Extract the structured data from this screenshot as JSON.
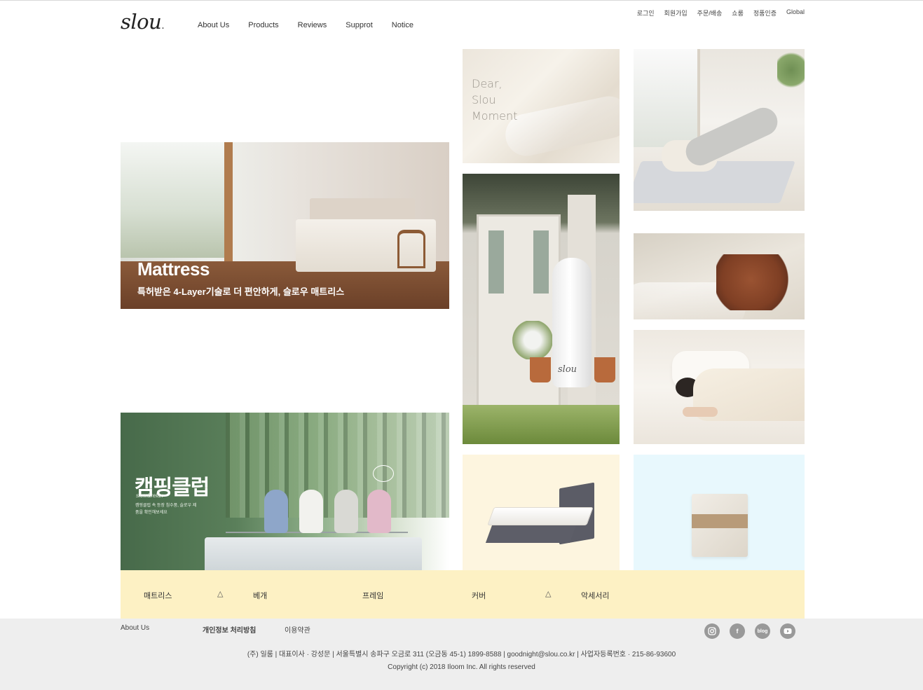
{
  "brand": {
    "logo_text": "slou",
    "logo_dot": "."
  },
  "nav": {
    "items": [
      "About Us",
      "Products",
      "Reviews",
      "Supprot",
      "Notice"
    ]
  },
  "utility": {
    "items": [
      "로그인",
      "회원가입",
      "주문/배송",
      "쇼룸",
      "정품인증",
      "Global"
    ]
  },
  "hero": {
    "title": "Mattress",
    "subtitle": "특허받은 4-Layer기술로 더 편안하게, 슬로우 매트리스"
  },
  "camping": {
    "title": "캠핑클럽",
    "signature": "slow&relax",
    "desc": "캠핑클럽 속 등장 침수품, 슬로우 제품을 확인해보세요"
  },
  "dear": {
    "lines": [
      "Dear,",
      "Slou",
      "Moment"
    ]
  },
  "roll_label": "slou",
  "categories": {
    "items": [
      "매트리스",
      "베개",
      "프레임",
      "커버",
      "악세서리"
    ],
    "arrow": "△"
  },
  "footer": {
    "links": [
      "About Us",
      "개인정보 처리방침",
      "이용약관"
    ],
    "social": {
      "instagram": "instagram-icon",
      "facebook": "f",
      "blog": "blog",
      "youtube": "youtube-icon"
    },
    "info": "(주) 일룸 | 대표이사 · 강성문 | 서울특별시 송파구 오금로 311 (오금동 45-1) 1899-8588 | goodnight@slou.co.kr | 사업자등록번호 · 215-86-93600",
    "copyright": "Copyright (c) 2018 Iloom Inc. All rights reserved"
  },
  "colors": {
    "category_bar": "#fdf1c4",
    "frame_bg": "#fdf5df",
    "accessory_bg": "#e8f8fd",
    "footer_bg": "#eeeeee",
    "social_icon": "#999999"
  }
}
